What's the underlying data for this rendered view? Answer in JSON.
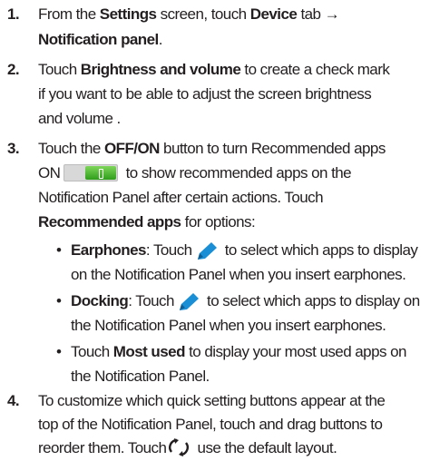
{
  "steps": [
    {
      "num": "1.",
      "lines": [
        {
          "a": "From the ",
          "b": "Settings",
          "c": " screen, touch ",
          "d": "Device",
          "e": " tab →"
        },
        {
          "b": "Notification panel",
          "c": "."
        }
      ]
    },
    {
      "num": "2.",
      "lines": [
        {
          "a": "Touch ",
          "b": "Brightness and volume",
          "c": " to create a check mark"
        },
        {
          "a": "if you want to be able to adjust the screen brightness"
        },
        {
          "a": "and volume ."
        }
      ]
    },
    {
      "num": "3.",
      "lines": [
        {
          "a": "Touch the ",
          "b": "OFF/ON",
          "c": " button to turn Recommended apps"
        },
        {
          "a": "ON",
          "c": " to show recommended apps on the"
        },
        {
          "a": "Notification Panel after certain actions. Touch"
        },
        {
          "b": "Recommended apps",
          "c": " for options:"
        }
      ],
      "bullets": [
        {
          "dot": "•",
          "l1b": "Earphones",
          "l1c": ": Touch",
          "l1d": " to select which apps to display",
          "l2": "on the Notification Panel when you insert earphones."
        },
        {
          "dot": "•",
          "l1b": "Docking",
          "l1c": ": Touch",
          "l1d": " to select which apps to display on",
          "l2": "the Notification Panel when you insert earphones."
        },
        {
          "dot": "•",
          "l1a": "Touch ",
          "l1b": "Most used",
          "l1c": " to display your most used apps on",
          "l2": "the Notification Panel."
        }
      ]
    },
    {
      "num": "4.",
      "lines": [
        {
          "a": "To customize which quick setting buttons appear at the"
        },
        {
          "a": "top of the Notification Panel, touch and drag buttons to"
        },
        {
          "a": "reorder them. Touch",
          "c": " use the default layout."
        }
      ]
    }
  ],
  "icons": {
    "toggle": "toggle-on-icon",
    "pencil": "pencil-icon",
    "refresh": "refresh-icon"
  },
  "colors": {
    "text": "#231f20",
    "pencil": "#1a8fd6",
    "toggle_on": "#3aa82a"
  }
}
